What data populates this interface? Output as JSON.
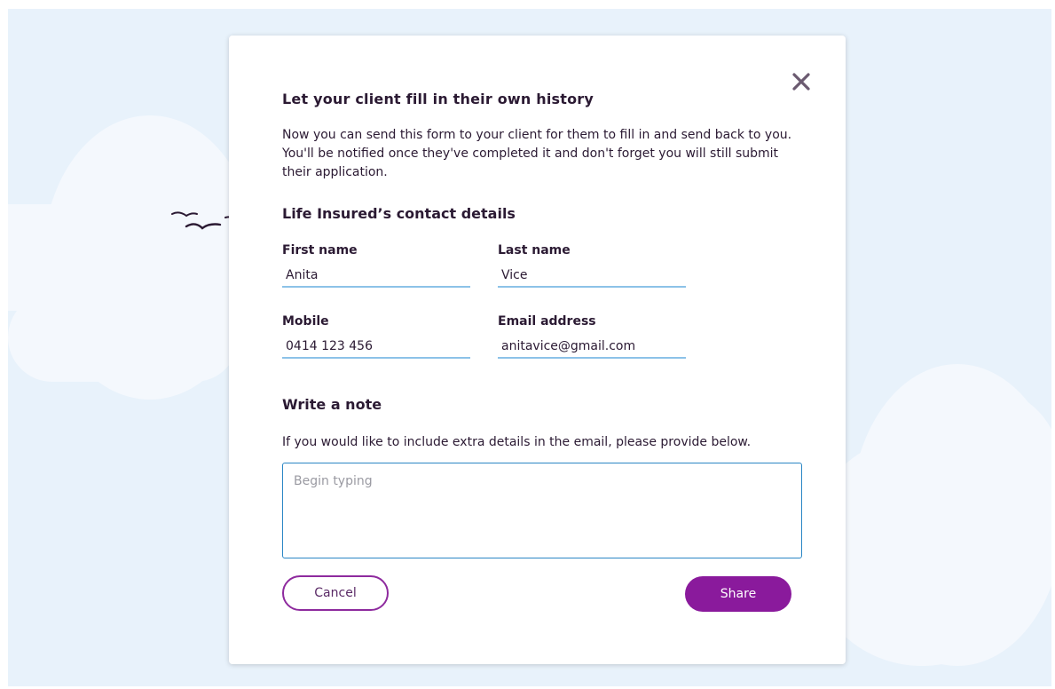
{
  "dialog": {
    "title": "Let your client fill in their own history",
    "intro": "Now you can send this form to your client for them to fill in and send back to you. You'll be notified once they've completed it and don't forget you will still submit their application.",
    "close_icon": "close-icon"
  },
  "contact": {
    "section_title": "Life Insured’s contact details",
    "first_name": {
      "label": "First name",
      "value": "Anita"
    },
    "last_name": {
      "label": "Last name",
      "value": "Vice"
    },
    "mobile": {
      "label": "Mobile",
      "value": "0414 123 456"
    },
    "email": {
      "label": "Email address",
      "value": "anitavice@gmail.com"
    }
  },
  "note": {
    "title": "Write a note",
    "help": "If you would like to include extra details in the email, please provide below.",
    "placeholder": "Begin typing",
    "value": ""
  },
  "actions": {
    "cancel_label": "Cancel",
    "share_label": "Share"
  },
  "colors": {
    "background": "#e8f2fb",
    "accent": "#8a1a9c",
    "input_underline": "#8cc2e8",
    "text": "#2b1a33"
  }
}
